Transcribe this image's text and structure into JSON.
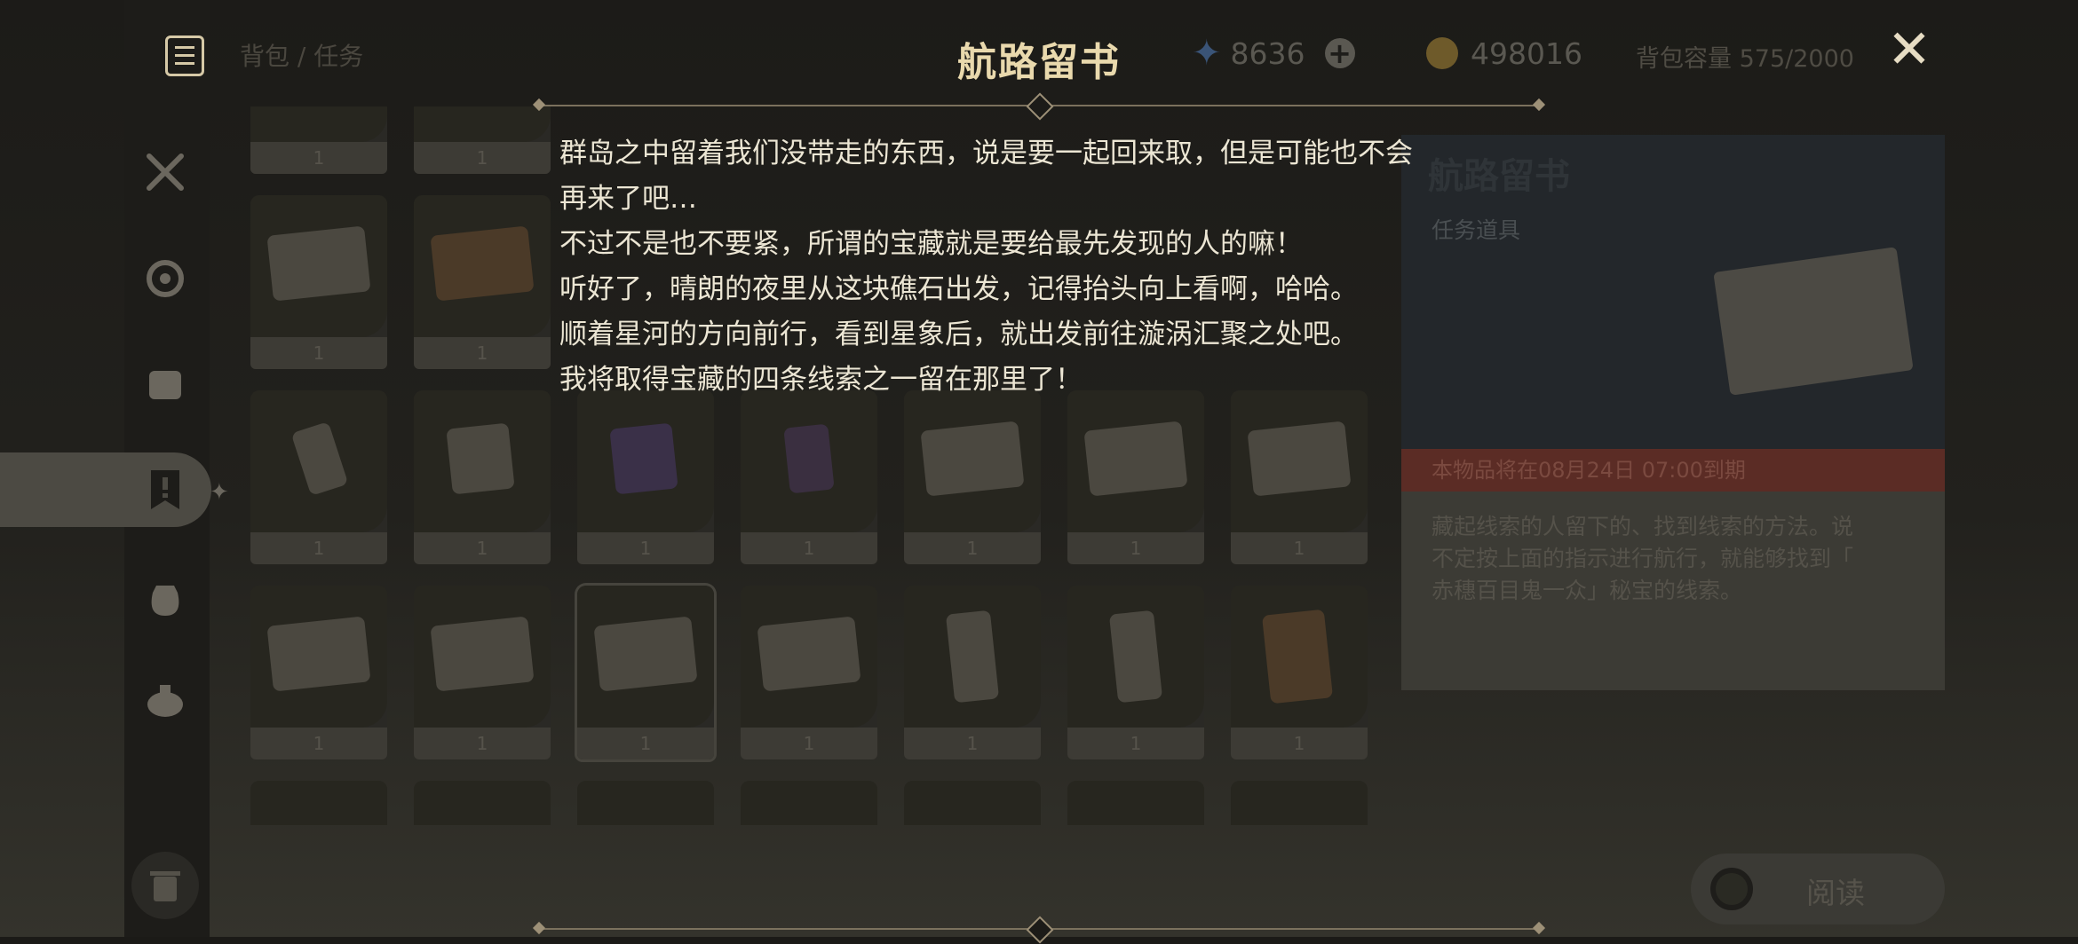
{
  "header": {
    "title": "航路留书",
    "breadcrumb": "背包 / 任务",
    "currency_primogem": "8636",
    "currency_mora": "498016",
    "capacity": "背包容量 575/2000",
    "add_icon": "plus-icon",
    "close_icon": "close-icon"
  },
  "story_text": [
    "群岛之中留着我们没带走的东西，说是要一起回来取，但是可能也不会",
    "再来了吧…",
    "不过不是也不要紧，所谓的宝藏就是要给最先发现的人的嘛！",
    "听好了，晴朗的夜里从这块礁石出发，记得抬头向上看啊，哈哈。",
    "顺着星河的方向前行，看到星象后，就出发前往漩涡汇聚之处吧。",
    "我将取得宝藏的四条线索之一留在那里了！"
  ],
  "detail": {
    "title": "航路留书",
    "category": "任务道具",
    "expiry": "本物品将在08月24日 07:00到期",
    "description_lines": [
      "藏起线索的人留下的、找到线索的方法。说",
      "不定按上面的指示进行航行，就能够找到「",
      "赤穗百目鬼一众」秘宝的线索。"
    ]
  },
  "read_button": {
    "label": "阅读"
  },
  "sidebar": {
    "icons": [
      "weapon-icon",
      "artifact-icon",
      "material-icon",
      "quest-icon",
      "precious-icon",
      "gadget-icon"
    ],
    "delete_icon": "trash-icon"
  },
  "grid_counts": [
    "1",
    "1",
    "1",
    "1",
    "1",
    "1",
    "1",
    "1",
    "1",
    "1",
    "1",
    "1",
    "1",
    "1",
    "1",
    "1",
    "1",
    "1"
  ],
  "colors": {
    "title": "#e9d9ad",
    "story_text": "#ece6d4",
    "expiry_banner": "#5b2c25"
  }
}
